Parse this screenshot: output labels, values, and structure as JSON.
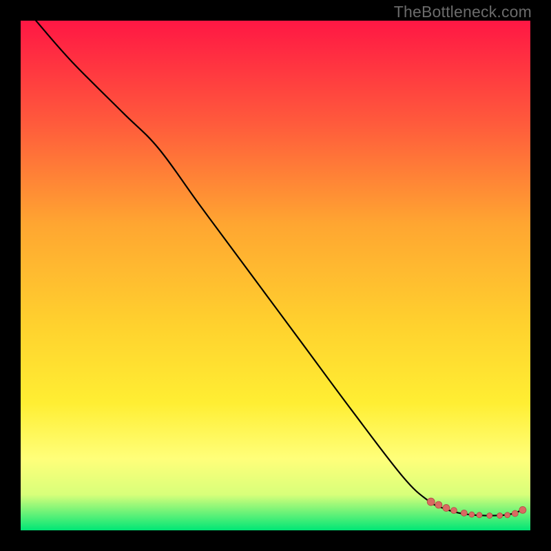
{
  "watermark": "TheBottleneck.com",
  "colors": {
    "marker_fill": "#d96a62",
    "marker_stroke": "#b24b44",
    "curve": "#000000",
    "background_black": "#000000"
  },
  "chart_data": {
    "type": "line",
    "title": "",
    "xlabel": "",
    "ylabel": "",
    "xlim": [
      0,
      100
    ],
    "ylim": [
      0,
      100
    ],
    "gradient_stops": [
      {
        "offset": 0,
        "color": "#ff1744"
      },
      {
        "offset": 20,
        "color": "#ff5a3c"
      },
      {
        "offset": 40,
        "color": "#ffa631"
      },
      {
        "offset": 60,
        "color": "#ffd22e"
      },
      {
        "offset": 75,
        "color": "#ffee33"
      },
      {
        "offset": 86,
        "color": "#ffff7a"
      },
      {
        "offset": 93,
        "color": "#d8ff7a"
      },
      {
        "offset": 100,
        "color": "#00e676"
      }
    ],
    "series": [
      {
        "name": "bottleneck-curve",
        "x": [
          3,
          10,
          20,
          27,
          35,
          45,
          55,
          65,
          75,
          80,
          83,
          86,
          89,
          92,
          95,
          97,
          98.5
        ],
        "y": [
          100,
          92,
          82,
          75,
          64,
          50.5,
          37,
          23.5,
          10.5,
          5.8,
          4.3,
          3.4,
          3.0,
          2.9,
          3.0,
          3.4,
          4.1
        ]
      }
    ],
    "markers": {
      "name": "highlighted-points",
      "x": [
        80.5,
        82,
        83.5,
        85,
        87,
        88.5,
        90,
        92,
        94,
        95.5,
        97,
        98.5
      ],
      "y": [
        5.6,
        5.0,
        4.4,
        3.9,
        3.4,
        3.1,
        3.0,
        2.9,
        2.9,
        3.0,
        3.3,
        4.0
      ],
      "r": [
        5.5,
        5,
        5,
        4.5,
        4.5,
        4,
        4,
        4,
        4,
        4,
        4.5,
        5
      ]
    }
  }
}
